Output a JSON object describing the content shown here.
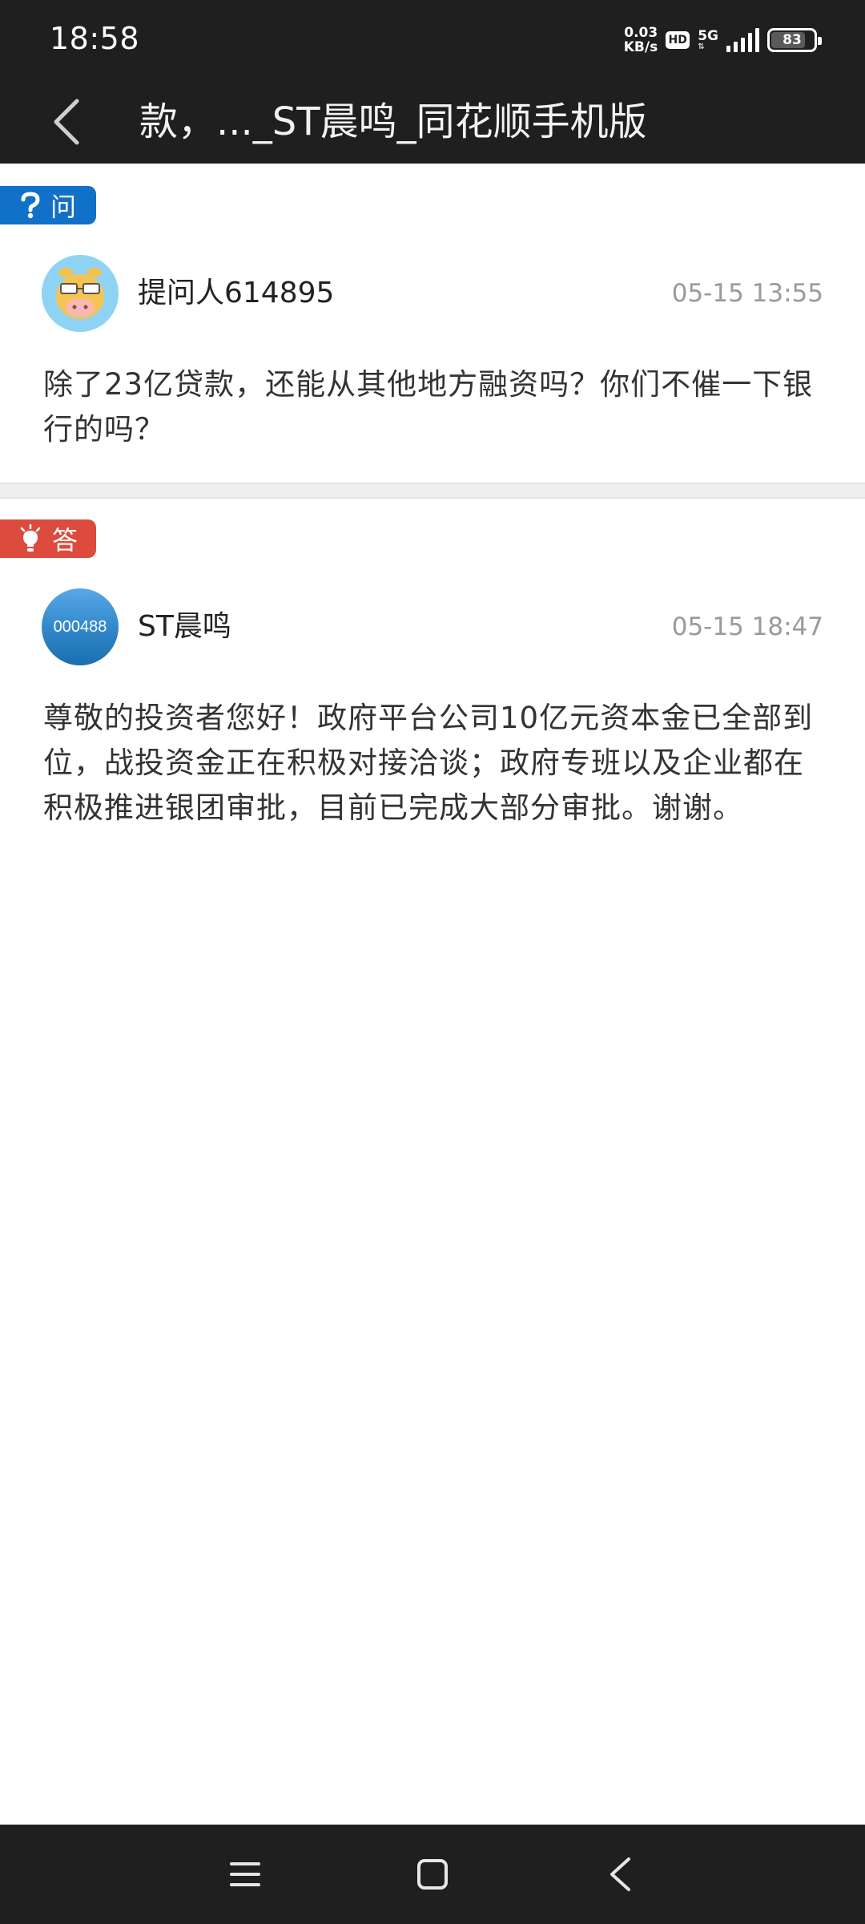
{
  "status_bar": {
    "time": "18:58",
    "net_speed_value": "0.03",
    "net_speed_unit": "KB/s",
    "hd_label": "HD",
    "network_label": "5G",
    "battery_level": "83",
    "battery_fraction": 0.83
  },
  "header": {
    "title": "款，..._ST晨鸣_同花顺手机版",
    "back_icon": "chevron-left-icon"
  },
  "question": {
    "badge_icon": "question-mark-icon",
    "badge_label": "问",
    "user_name": "提问人614895",
    "timestamp": "05-15 13:55",
    "text": "除了23亿贷款，还能从其他地方融资吗？你们不催一下银行的吗？"
  },
  "answer": {
    "badge_icon": "lightbulb-icon",
    "badge_label": "答",
    "avatar_code": "000488",
    "user_name": "ST晨鸣",
    "timestamp": "05-15 18:47",
    "text": "尊敬的投资者您好！政府平台公司10亿元资本金已全部到位，战投资金正在积极对接洽谈；政府专班以及企业都在积极推进银团审批，目前已完成大部分审批。谢谢。"
  },
  "nav_bar": {
    "menu_icon": "menu-icon",
    "home_icon": "home-square-icon",
    "back_icon": "back-triangle-icon"
  },
  "colors": {
    "bar_background": "#1f1f1f",
    "question_badge": "#1170c8",
    "answer_badge": "#dc4b3d",
    "timestamp_text": "#9a9a9a"
  }
}
